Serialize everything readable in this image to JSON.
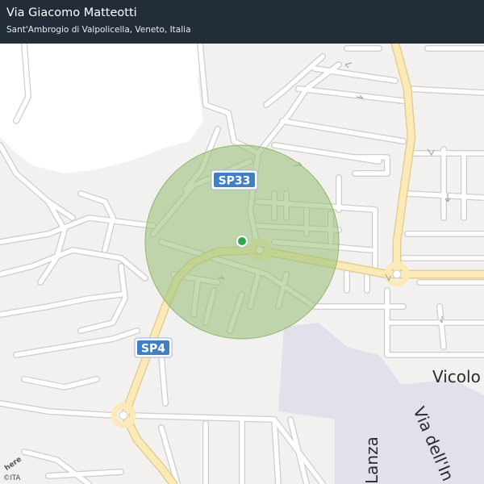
{
  "header": {
    "title": "Via Giacomo Matteotti",
    "subtitle": "Sant'Ambrogio di Valpolicella, Veneto, Italia"
  },
  "map": {
    "road_shields": [
      {
        "label": "SP33"
      },
      {
        "label": "SP4"
      }
    ],
    "street_labels": [
      {
        "text": "Vicolo"
      },
      {
        "text": "Lanza"
      },
      {
        "text": "Via dell'In"
      }
    ],
    "location_marker": {
      "name": "current-location"
    },
    "colors": {
      "background": "#f2f1f0",
      "park": "#ffffff",
      "industrial": "#e0e0ea",
      "minor_road": "#ffffff",
      "road_casing": "#cfcdc9",
      "major_road": "#fbe9b2",
      "major_road_casing": "#e6d08c",
      "accuracy_circle": "#9dc27b",
      "marker": "#2ea84a",
      "shield": "#3f7fc5"
    }
  },
  "attribution": {
    "logo": "here",
    "copyright": "©ITA"
  }
}
